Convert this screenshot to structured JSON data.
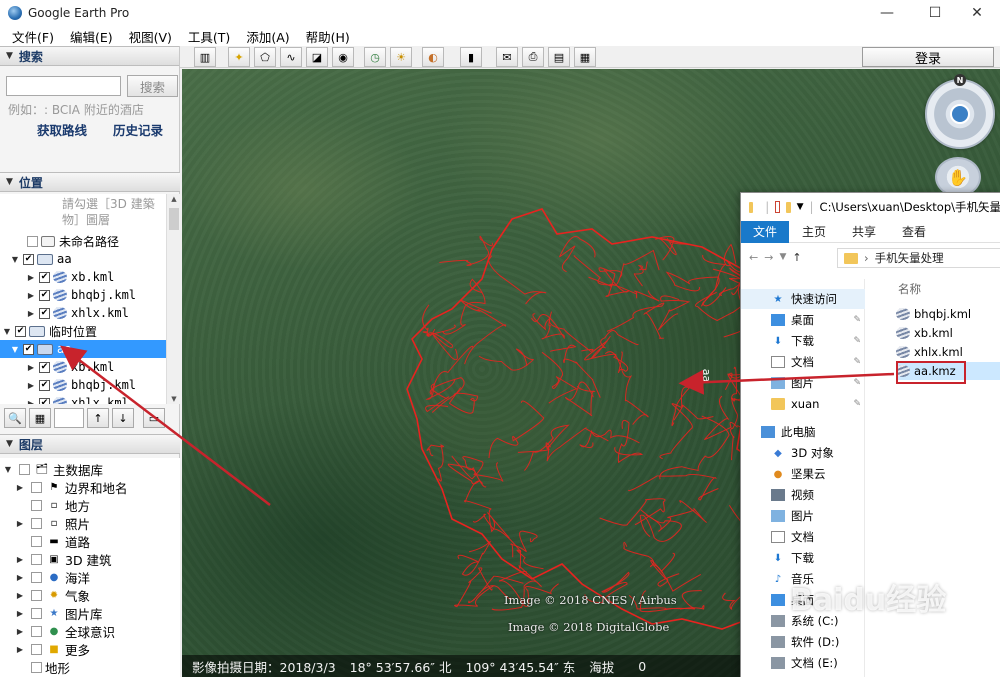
{
  "window": {
    "title": "Google Earth Pro",
    "minimize": "—",
    "maximize": "☐",
    "close": "✕"
  },
  "menu": [
    "文件(F)",
    "编辑(E)",
    "视图(V)",
    "工具(T)",
    "添加(A)",
    "帮助(H)"
  ],
  "search": {
    "header": "搜索",
    "placeholder": "",
    "button": "搜索",
    "hint": "例如：: BCIA 附近的酒店",
    "route_link": "获取路线",
    "history_link": "历史记录"
  },
  "places": {
    "header": "位置",
    "rows": [
      {
        "label": "請勾選［3D 建築",
        "indent": 62,
        "gray": true
      },
      {
        "label": "物］圖層",
        "indent": 62,
        "gray": true
      },
      {
        "label": "未命名路径",
        "indent": 28
      },
      {
        "label": "aa",
        "indent": 12
      },
      {
        "label": "xb.kml",
        "indent": 28
      },
      {
        "label": "bhqbj.kml",
        "indent": 28
      },
      {
        "label": "xhlx.kml",
        "indent": 28
      },
      {
        "label": "临时位置",
        "indent": 4
      },
      {
        "label": "aa",
        "indent": 12
      },
      {
        "label": "xb.kml",
        "indent": 28
      },
      {
        "label": "bhqbj.kml",
        "indent": 28
      },
      {
        "label": "xhlx.kml",
        "indent": 28
      }
    ]
  },
  "layers": {
    "header": "图层",
    "items": [
      "主数据库",
      "边界和地名",
      "地方",
      "照片",
      "道路",
      "3D 建筑",
      "海洋",
      "气象",
      "图片库",
      "全球意识",
      "更多",
      "地形"
    ]
  },
  "toolbar": {
    "login": "登录"
  },
  "map": {
    "credit_1": "Image © 2018 CNES / Airbus",
    "credit_2": "Image © 2018 DigitalGlobe",
    "status_date": "影像拍摄日期：2018/3/3",
    "status_lat": "18° 53′57.66″ 北",
    "status_lon": "109° 43′45.54″ 东",
    "status_alt": "海拔",
    "status_tail": "0",
    "north": "N",
    "label_near_arrow": "aa",
    "overlay_color": "#e8231f"
  },
  "explorer": {
    "path": "C:\\Users\\xuan\\Desktop\\手机矢量",
    "tab_file": "文件",
    "tab_home": "主页",
    "tab_share": "共享",
    "tab_view": "查看",
    "breadcrumb": "手机矢量处理",
    "column_name": "名称",
    "nav": [
      "快速访问",
      "桌面",
      "下载",
      "文档",
      "图片",
      "xuan",
      "此电脑",
      "3D 对象",
      "坚果云",
      "视频",
      "图片",
      "文档",
      "下载",
      "音乐",
      "桌面",
      "系统 (C:)",
      "软件 (D:)",
      "文档 (E:)"
    ],
    "files": [
      "bhqbj.kml",
      "xb.kml",
      "xhlx.kml",
      "aa.kmz"
    ]
  },
  "watermark": "Baidu经验"
}
